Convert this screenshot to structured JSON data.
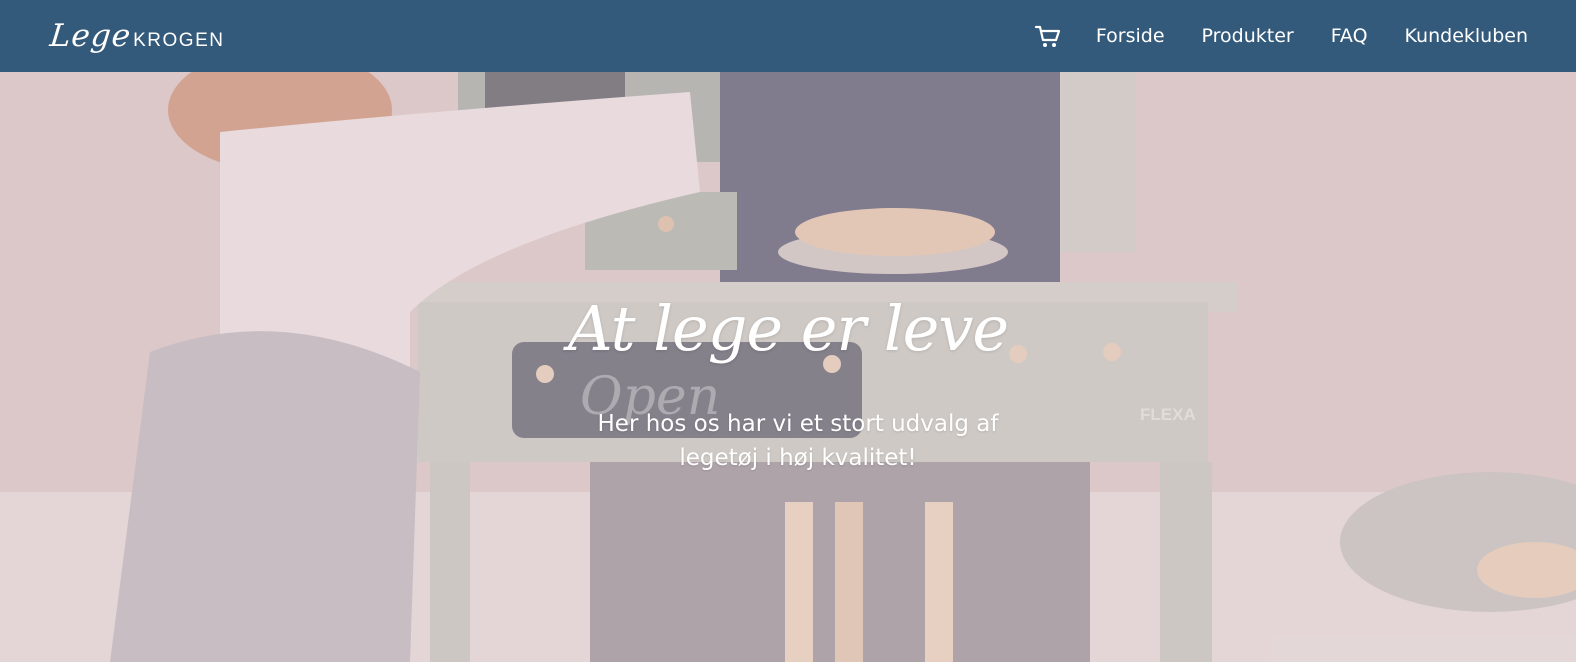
{
  "header": {
    "logo_script": "Lege",
    "logo_caps": "KROGEN",
    "cart_icon": "shopping-cart-icon",
    "nav": [
      {
        "label": "Forside"
      },
      {
        "label": "Produkter"
      },
      {
        "label": "FAQ"
      },
      {
        "label": "Kundeklub​en"
      }
    ]
  },
  "hero": {
    "title": "At lege er leve",
    "subtitle": "Her hos os har vi et stort udvalg af legetøj i høj kvalitet!",
    "chalkboard_text": "Open",
    "brand_text": "FLEXA"
  },
  "colors": {
    "navbar": "#345a7b",
    "text": "#ffffff"
  }
}
